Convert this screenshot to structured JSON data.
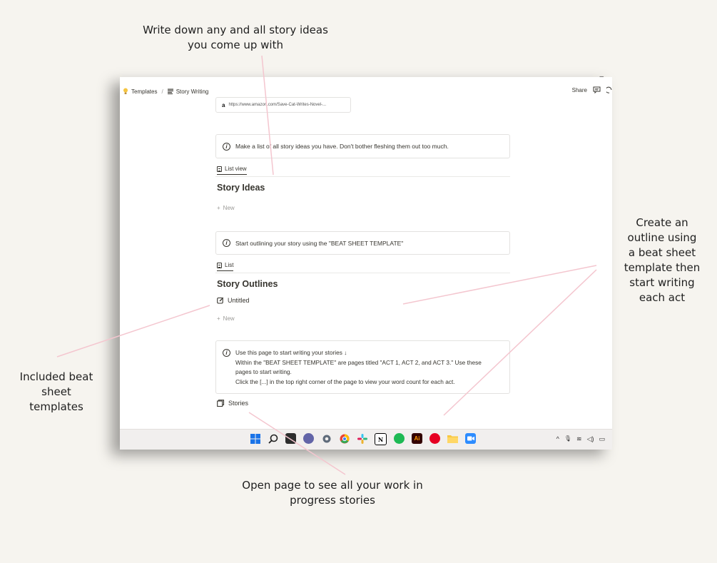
{
  "annotations": {
    "story_ideas": "Write down any and all story ideas\nyou come up with",
    "outline": "Create an\noutline using\na beat sheet\ntemplate then\nstart writing\neach act",
    "beat_sheet": "Included beat\nsheet\ntemplates",
    "progress": "Open page to see all your work in\nprogress stories"
  },
  "window": {
    "breadcrumb": [
      "Templates",
      "Story Writing"
    ],
    "share_label": "Share",
    "minimize_glyph": "–"
  },
  "content": {
    "link_url": "https://www.amazon.com/Save-Cat-Writes-Novel-...",
    "callout_ideas": "Make a list of all story ideas you have. Don't bother fleshing them out too much.",
    "tab_list_view": "List view",
    "heading_ideas": "Story Ideas",
    "new_label": "New",
    "callout_outline": "Start outlining your story using the \"BEAT SHEET TEMPLATE\"",
    "tab_list": "List",
    "heading_outlines": "Story Outlines",
    "untitled_label": "Untitled",
    "callout_stories": [
      "Use this page to start writing your stories ↓",
      "Within the \"BEAT SHEET TEMPLATE\" are pages titled \"ACT 1, ACT 2, and ACT 3.\" Use these",
      "pages to start writing.",
      "Click the [...] in the top right corner of the page to view your word count for each act."
    ],
    "stories_label": "Stories"
  },
  "taskbar": {
    "icons": [
      "windows-start-icon",
      "search-icon",
      "file-explorer-dark-icon",
      "teams-chat-icon",
      "settings-icon",
      "chrome-icon",
      "slack-icon",
      "notion-icon",
      "spotify-icon",
      "adobe-icon",
      "pinterest-icon",
      "folder-icon",
      "zoom-icon"
    ],
    "notion_glyph": "N",
    "adobe_glyph": "Ai",
    "tray_glyphs": [
      "^",
      "🎙",
      "≋",
      "◁)",
      "▭"
    ]
  },
  "colors": {
    "background": "#f6f4ef",
    "annotation_line": "#f4c6cf",
    "text": "#37352f",
    "muted": "#9b9a97"
  }
}
